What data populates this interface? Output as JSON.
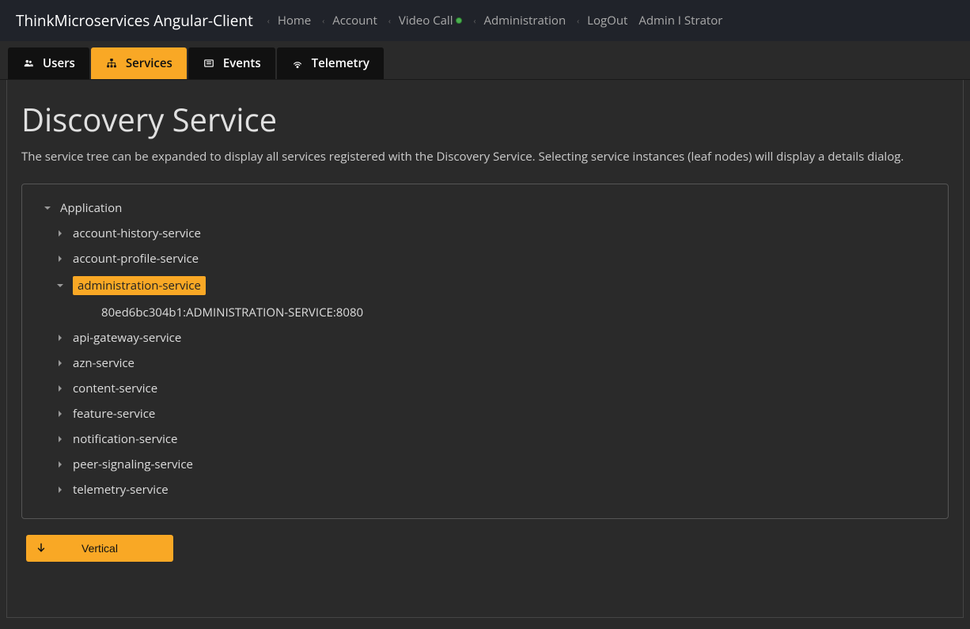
{
  "header": {
    "app_title": "ThinkMicroservices Angular-Client",
    "links": {
      "home": "Home",
      "account": "Account",
      "video_call": "Video Call",
      "administration": "Administration",
      "logout": "LogOut",
      "user": "Admin I Strator"
    }
  },
  "tabs": {
    "users": "Users",
    "services": "Services",
    "events": "Events",
    "telemetry": "Telemetry"
  },
  "page": {
    "title": "Discovery Service",
    "description": "The service tree can be expanded to display all services registered with the Discovery Service. Selecting service instances (leaf nodes) will display a details dialog."
  },
  "tree": {
    "root": "Application",
    "services": {
      "account_history": "account-history-service",
      "account_profile": "account-profile-service",
      "administration": "administration-service",
      "administration_instance": "80ed6bc304b1:ADMINISTRATION-SERVICE:8080",
      "api_gateway": "api-gateway-service",
      "azn": "azn-service",
      "content": "content-service",
      "feature": "feature-service",
      "notification": "notification-service",
      "peer_signaling": "peer-signaling-service",
      "telemetry": "telemetry-service"
    }
  },
  "buttons": {
    "vertical": "Vertical"
  }
}
